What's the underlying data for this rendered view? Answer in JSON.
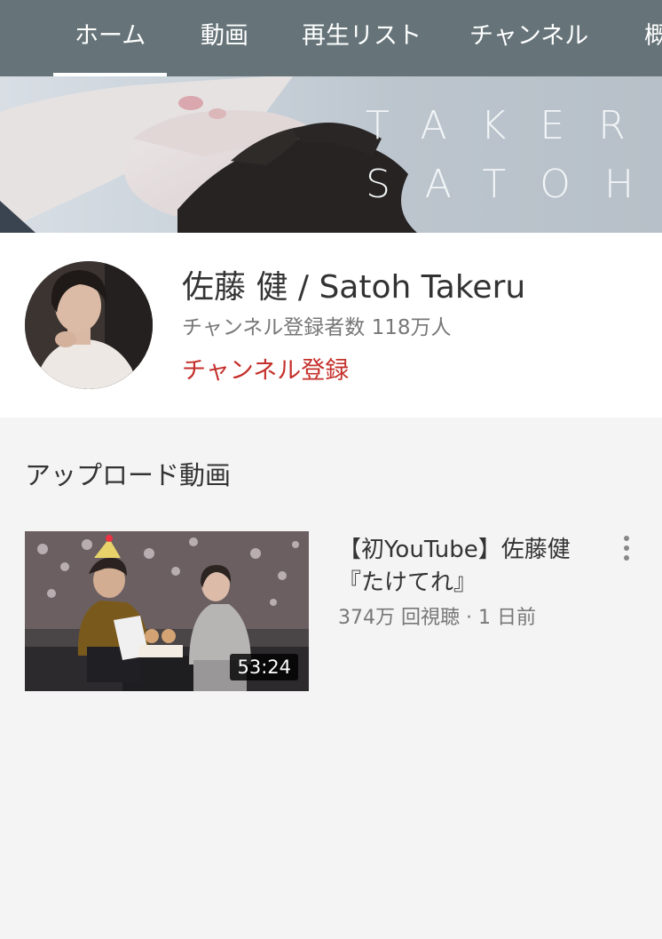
{
  "tabs": [
    {
      "label": "ホーム",
      "active": true
    },
    {
      "label": "動画",
      "active": false
    },
    {
      "label": "再生リスト",
      "active": false
    },
    {
      "label": "チャンネル",
      "active": false
    },
    {
      "label": "概",
      "active": false
    }
  ],
  "banner": {
    "title_line1": "TAKERU",
    "title_line2": "SATOH"
  },
  "channel": {
    "name": "佐藤 健 / Satoh Takeru",
    "subscribers": "チャンネル登録者数 118万人",
    "subscribe_label": "チャンネル登録"
  },
  "uploads": {
    "section_title": "アップロード動画",
    "videos": [
      {
        "title": "【初YouTube】佐藤健『たけてれ』",
        "meta": "374万 回視聴 · 1 日前",
        "duration": "53:24"
      }
    ]
  },
  "colors": {
    "tabbar_bg": "#667479",
    "accent_red": "#c4302b",
    "page_bg": "#f4f4f4"
  }
}
